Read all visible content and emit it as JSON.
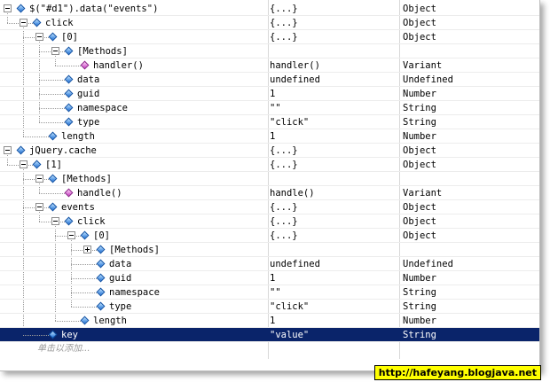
{
  "rows": [
    {
      "name": "$(\"#d1\").data(\"events\")",
      "value": "{...}",
      "type": "Object"
    },
    {
      "name": "click",
      "value": "{...}",
      "type": "Object"
    },
    {
      "name": "[0]",
      "value": "{...}",
      "type": "Object"
    },
    {
      "name": "[Methods]",
      "value": "",
      "type": ""
    },
    {
      "name": "handler()",
      "value": "handler()",
      "type": "Variant"
    },
    {
      "name": "data",
      "value": "undefined",
      "type": "Undefined"
    },
    {
      "name": "guid",
      "value": "1",
      "type": "Number"
    },
    {
      "name": "namespace",
      "value": "\"\"",
      "type": "String"
    },
    {
      "name": "type",
      "value": "\"click\"",
      "type": "String"
    },
    {
      "name": "length",
      "value": "1",
      "type": "Number"
    },
    {
      "name": "jQuery.cache",
      "value": "{...}",
      "type": "Object"
    },
    {
      "name": "[1]",
      "value": "{...}",
      "type": "Object"
    },
    {
      "name": "[Methods]",
      "value": "",
      "type": ""
    },
    {
      "name": "handle()",
      "value": "handle()",
      "type": "Variant"
    },
    {
      "name": "events",
      "value": "{...}",
      "type": "Object"
    },
    {
      "name": "click",
      "value": "{...}",
      "type": "Object"
    },
    {
      "name": "[0]",
      "value": "{...}",
      "type": "Object"
    },
    {
      "name": "[Methods]",
      "value": "",
      "type": ""
    },
    {
      "name": "data",
      "value": "undefined",
      "type": "Undefined"
    },
    {
      "name": "guid",
      "value": "1",
      "type": "Number"
    },
    {
      "name": "namespace",
      "value": "\"\"",
      "type": "String"
    },
    {
      "name": "type",
      "value": "\"click\"",
      "type": "String"
    },
    {
      "name": "length",
      "value": "1",
      "type": "Number"
    },
    {
      "name": "key",
      "value": "\"value\"",
      "type": "String"
    }
  ],
  "add_row_hint": "单击以添加...",
  "watermark": "http://hafeyang.blogjava.net",
  "colors": {
    "selected_bg": "#0a246a",
    "object_icon": "#1c6fd6",
    "method_icon": "#c43cc2",
    "watermark_bg": "#ffff00"
  }
}
